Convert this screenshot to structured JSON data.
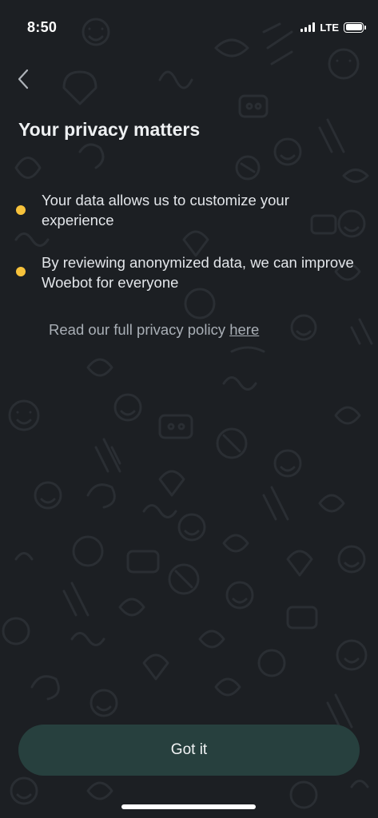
{
  "status_bar": {
    "time": "8:50",
    "network": "LTE",
    "signal_bars": 4,
    "battery_level": 1.0
  },
  "header": {
    "back_icon": "chevron-left-icon",
    "title": "Your privacy matters"
  },
  "bullets": [
    {
      "text": "Your data allows us to customize your experience"
    },
    {
      "text": "By reviewing anonymized data, we can improve Woebot for everyone"
    }
  ],
  "policy": {
    "text": "Read our full privacy policy ",
    "link_label": "here"
  },
  "footer": {
    "button_label": "Got it"
  },
  "colors": {
    "background": "#1c1f23",
    "accent": "#f7c23b",
    "button_bg": "#27403e",
    "pattern": "#2a2e33"
  }
}
